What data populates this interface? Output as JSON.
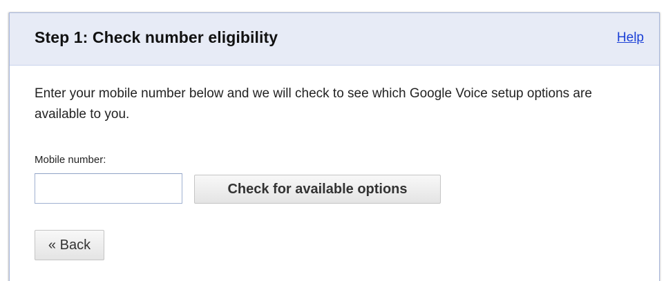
{
  "panel": {
    "title": "Step 1: Check number eligibility",
    "help_link": "Help"
  },
  "body": {
    "intro": "Enter your mobile number below and we will check to see which Google Voice setup options are available to you."
  },
  "form": {
    "mobile_label": "Mobile number:",
    "mobile_value": "",
    "check_button": "Check for available options",
    "back_button": "« Back"
  },
  "colors": {
    "header_bg": "#e7ebf6",
    "link": "#1a3fd6",
    "panel_border": "#a9b8dd"
  }
}
